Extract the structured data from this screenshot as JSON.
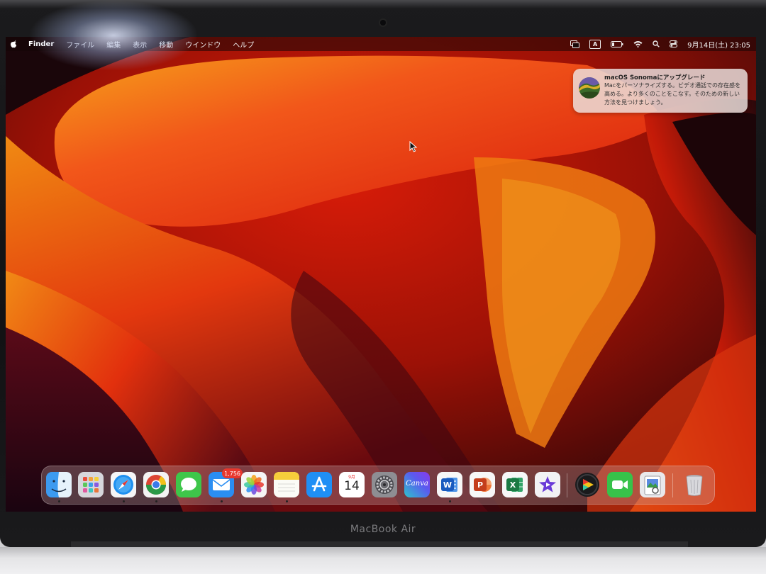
{
  "menubar": {
    "app_name": "Finder",
    "items": [
      "ファイル",
      "編集",
      "表示",
      "移動",
      "ウインドウ",
      "ヘルプ"
    ],
    "input_indicator": "A",
    "datetime": "9月14日(土) 23:05"
  },
  "notification": {
    "title": "macOS Sonomaにアップグレード",
    "body": "Macをパーソナライズする。ビデオ通話での存在感を高める。より多くのことをこなす。そのための新しい方法を見つけましょう。"
  },
  "dock": {
    "apps": [
      {
        "name": "finder-icon",
        "running": true
      },
      {
        "name": "launchpad-icon",
        "running": false
      },
      {
        "name": "safari-icon",
        "running": true
      },
      {
        "name": "chrome-icon",
        "running": true
      },
      {
        "name": "messages-icon",
        "running": false
      },
      {
        "name": "mail-icon",
        "running": true,
        "badge": "1,756"
      },
      {
        "name": "photos-icon",
        "running": false
      },
      {
        "name": "notes-icon",
        "running": true
      },
      {
        "name": "app-store-icon",
        "running": false
      },
      {
        "name": "calendar-icon",
        "running": false,
        "month": "9月",
        "day": "14"
      },
      {
        "name": "system-settings-icon",
        "running": false
      },
      {
        "name": "canva-icon",
        "running": false,
        "label": "Canva"
      },
      {
        "name": "word-icon",
        "running": true,
        "letter": "W"
      },
      {
        "name": "powerpoint-icon",
        "running": false,
        "letter": "P"
      },
      {
        "name": "excel-icon",
        "running": false,
        "letter": "X"
      },
      {
        "name": "imovie-icon",
        "running": false
      },
      {
        "name": "final-cut-icon",
        "running": false
      },
      {
        "name": "facetime-icon",
        "running": false
      },
      {
        "name": "preview-icon",
        "running": false
      },
      {
        "name": "trash-icon",
        "running": false
      }
    ]
  },
  "device_label": "MacBook Air",
  "colors": {
    "wallpaper_deep": "#3a0804",
    "wallpaper_red": "#e5200b",
    "wallpaper_orange": "#f27a10",
    "mail_badge": "#e8372d"
  }
}
